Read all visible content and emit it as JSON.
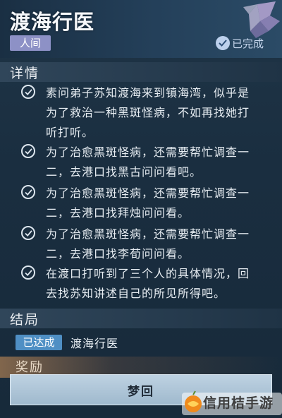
{
  "header": {
    "title": "渡海行医",
    "realm_tag": "人间",
    "status": "已完成"
  },
  "details": {
    "title": "详情",
    "items": [
      {
        "lines": [
          "素问弟子苏知渡海来到镇海湾，似乎是",
          "为了救治一种黑斑怪病，不如再找她打",
          "听打听。"
        ]
      },
      {
        "lines": [
          "为了治愈黑斑怪病，还需要帮忙调查一",
          "二，去港口找黑古问问看吧。"
        ]
      },
      {
        "lines": [
          "为了治愈黑斑怪病，还需要帮忙调查一",
          "二，去港口找拜烛问问看。"
        ]
      },
      {
        "lines": [
          "为了治愈黑斑怪病，还需要帮忙调查一",
          "二，去港口找李荀问问看。"
        ]
      },
      {
        "lines": [
          "在渡口打听到了三个人的具体情况，回",
          "去找苏知讲述自己的所见所得吧。"
        ]
      }
    ]
  },
  "ending": {
    "title": "结局",
    "achieved_tag": "已达成",
    "name": "渡海行医"
  },
  "reward": {
    "title": "奖励"
  },
  "button": {
    "label": "梦回"
  },
  "watermark": {
    "text": "信用桔手游"
  },
  "colors": {
    "realm_tag": "#8d91c6",
    "achieved_tag": "#4f8fc4",
    "button": "#b2c8da",
    "background": "#1a2e40"
  }
}
